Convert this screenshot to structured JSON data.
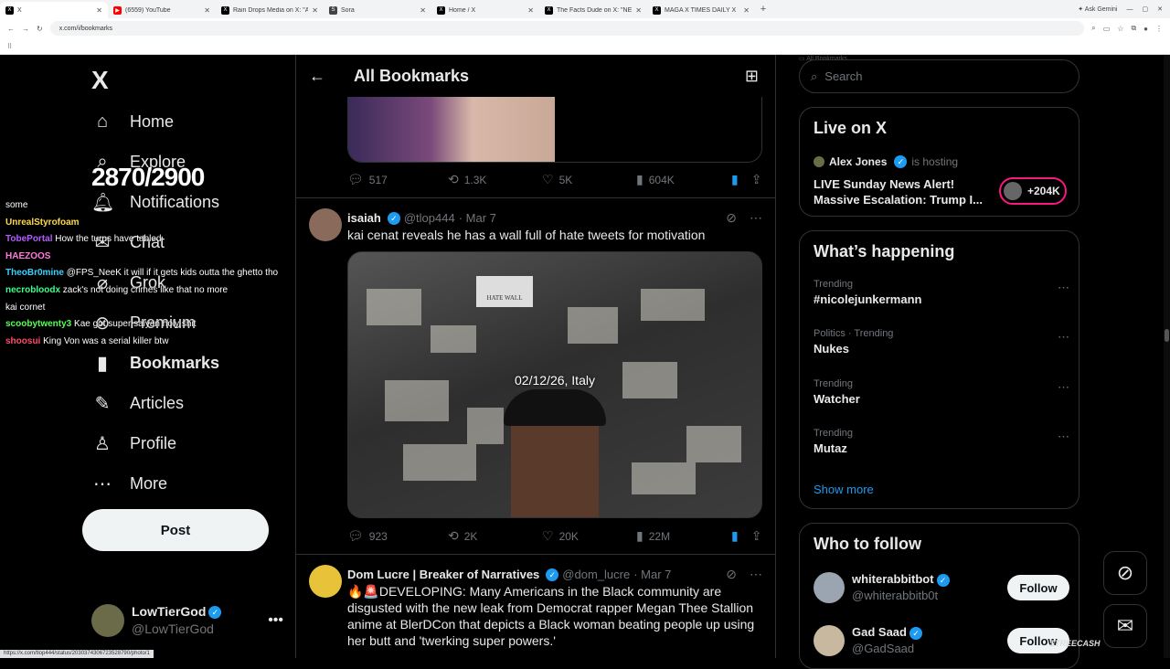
{
  "browser": {
    "tabs": [
      {
        "label": "X",
        "fav": "X",
        "color": "#000000",
        "active": true
      },
      {
        "label": "(6559) YouTube",
        "fav": "▶",
        "color": "#ff0000",
        "active": false
      },
      {
        "label": "Rain Drops Media on X: \"A stu",
        "fav": "X",
        "color": "#000000",
        "active": false
      },
      {
        "label": "Sora",
        "fav": "S",
        "color": "#444444",
        "active": false
      },
      {
        "label": "Home / X",
        "fav": "X",
        "color": "#000000",
        "active": false
      },
      {
        "label": "The Facts Dude on X: \"NEW",
        "fav": "X",
        "color": "#000000",
        "active": false
      },
      {
        "label": "MAGA X TIMES DAILY X",
        "fav": "X",
        "color": "#000000",
        "active": false
      }
    ],
    "new_tab": "+",
    "ask_gemini": "Ask Gemini",
    "url": "x.com/i/bookmarks",
    "all_bookmarks": "All Bookmarks",
    "status_url": "https://x.com/tlop444/status/2030374306723528790/photo/1"
  },
  "nav": {
    "logo": "X",
    "items": [
      {
        "label": "Home",
        "icon": "home-icon",
        "glyph": "⌂"
      },
      {
        "label": "Explore",
        "icon": "search-icon",
        "glyph": "⌕"
      },
      {
        "label": "Notifications",
        "icon": "bell-icon",
        "glyph": "🔔︎"
      },
      {
        "label": "Chat",
        "icon": "chat-icon",
        "glyph": "✉"
      },
      {
        "label": "Grok",
        "icon": "grok-icon",
        "glyph": "⌀"
      },
      {
        "label": "Premium",
        "icon": "premium-icon",
        "glyph": "⊗"
      },
      {
        "label": "Bookmarks",
        "icon": "bookmark-icon",
        "glyph": "▮",
        "bold": true
      },
      {
        "label": "Articles",
        "icon": "articles-icon",
        "glyph": "✎"
      },
      {
        "label": "Profile",
        "icon": "profile-icon",
        "glyph": "♙"
      },
      {
        "label": "More",
        "icon": "more-icon",
        "glyph": "⋯"
      }
    ],
    "post_label": "Post",
    "account": {
      "name": "LowTierGod",
      "handle": "@LowTierGod"
    }
  },
  "overlay": {
    "counter": "2870/2900",
    "chat": [
      {
        "user": "",
        "text": "some",
        "color": "#ffffff"
      },
      {
        "user": "UnrealStyrofoam",
        "text": "",
        "color": "#ffd84a"
      },
      {
        "user": "TobePortal",
        "text": "How the turns have tabled",
        "color": "#b45cff"
      },
      {
        "user": "HAEZOOS",
        "text": "",
        "color": "#ff7ad9"
      },
      {
        "user": "TheoBr0mine",
        "text": "@FPS_NeeK it will if it gets kids outta the ghetto tho",
        "color": "#3ad3ff"
      },
      {
        "user": "necrobloodx",
        "text": "zack's not doing crimes like that no more",
        "color": "#3dff8a"
      },
      {
        "user": "",
        "text": "kai cornet",
        "color": "#ffffff"
      },
      {
        "user": "scoobytwenty3",
        "text": "Kae got super saiyan holy shit",
        "color": "#55ff55"
      },
      {
        "user": "shoosui",
        "text": "King Von was a serial killer btw",
        "color": "#ff4a6a"
      }
    ]
  },
  "main": {
    "title": "All Bookmarks",
    "prev_tweet_actions": {
      "replies": "517",
      "reposts": "1.3K",
      "likes": "5K",
      "views": "604K"
    },
    "tweet1": {
      "name": "isaiah",
      "handle": "@tlop444",
      "date": "· Mar 7",
      "text": "kai cenat reveals he has a wall full of hate tweets for motivation",
      "media_overlay": "02/12/26, Italy",
      "media_sign": "HATE WALL",
      "actions": {
        "replies": "923",
        "reposts": "2K",
        "likes": "20K",
        "views": "22M"
      }
    },
    "tweet2": {
      "name": "Dom Lucre | Breaker of Narratives",
      "handle": "@dom_lucre",
      "date": "· Mar 7",
      "text": "🔥🚨DEVELOPING: Many Americans in the Black community are disgusted with the new leak from Democrat rapper Megan Thee Stallion anime at BlerDCon that depicts a Black woman beating people up using her butt and 'twerking super powers.'"
    }
  },
  "right": {
    "search_placeholder": "Search",
    "live": {
      "title": "Live on X",
      "host": "Alex Jones",
      "hosting": "is hosting",
      "stream_title": "LIVE Sunday News Alert! Massive Escalation: Trump I...",
      "listeners": "+204K"
    },
    "happening": {
      "title": "What’s happening",
      "trends": [
        {
          "context": "Trending",
          "topic": "#nicolejunkermann"
        },
        {
          "context": "Politics · Trending",
          "topic": "Nukes"
        },
        {
          "context": "Trending",
          "topic": "Watcher"
        },
        {
          "context": "Trending",
          "topic": "Mutaz"
        }
      ],
      "show_more": "Show more"
    },
    "who_to_follow": {
      "title": "Who to follow",
      "accounts": [
        {
          "name": "whiterabbitbot",
          "handle": "@whiterabbitb0t",
          "button": "Follow"
        },
        {
          "name": "Gad Saad",
          "handle": "@GadSaad",
          "button": "Follow"
        }
      ]
    }
  },
  "watermark": "STREECASH",
  "colors": {
    "accent": "#1d9bf0",
    "live_border": "#f91880",
    "background": "#000000"
  }
}
